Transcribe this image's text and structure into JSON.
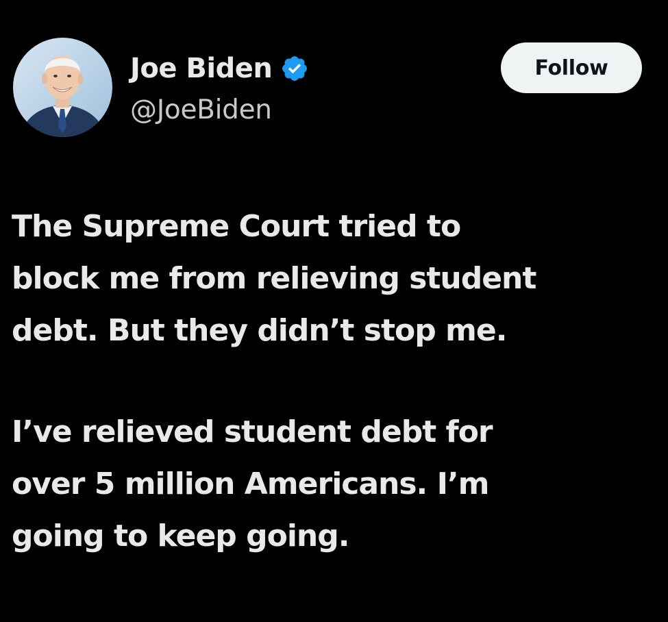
{
  "tweet": {
    "author": {
      "display_name": "Joe Biden",
      "handle": "@JoeBiden",
      "avatar_icon": "profile-photo",
      "verified_icon": "verified-badge-icon",
      "verified_color": "#1d9bf0"
    },
    "follow_label": "Follow",
    "paragraphs": [
      {
        "lines": [
          "The Supreme Court tried to",
          "block me from relieving student",
          "debt. But they didn’t stop me."
        ]
      },
      {
        "lines": [
          "I’ve relieved student debt for",
          "over 5 million Americans. I’m",
          "going to keep going."
        ]
      }
    ]
  },
  "colors": {
    "background": "#000000",
    "text_primary": "#e7e9ea",
    "text_secondary": "#c7c9ca",
    "button_bg": "#eff3f4",
    "button_text": "#0f1419"
  }
}
